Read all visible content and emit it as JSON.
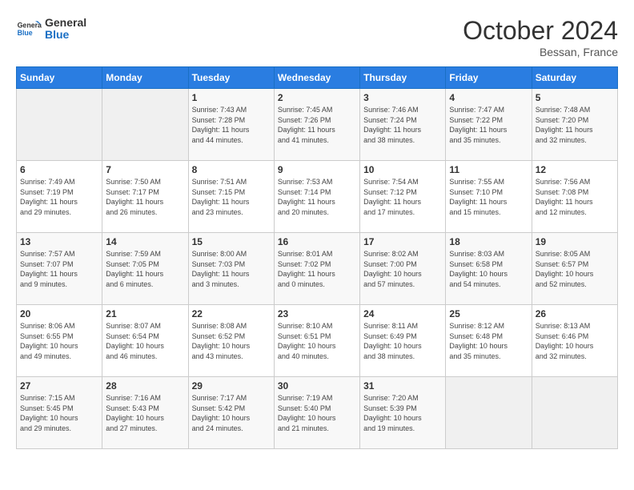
{
  "logo": {
    "line1": "General",
    "line2": "Blue"
  },
  "title": "October 2024",
  "location": "Bessan, France",
  "days_header": [
    "Sunday",
    "Monday",
    "Tuesday",
    "Wednesday",
    "Thursday",
    "Friday",
    "Saturday"
  ],
  "weeks": [
    [
      {
        "day": "",
        "info": ""
      },
      {
        "day": "",
        "info": ""
      },
      {
        "day": "1",
        "info": "Sunrise: 7:43 AM\nSunset: 7:28 PM\nDaylight: 11 hours\nand 44 minutes."
      },
      {
        "day": "2",
        "info": "Sunrise: 7:45 AM\nSunset: 7:26 PM\nDaylight: 11 hours\nand 41 minutes."
      },
      {
        "day": "3",
        "info": "Sunrise: 7:46 AM\nSunset: 7:24 PM\nDaylight: 11 hours\nand 38 minutes."
      },
      {
        "day": "4",
        "info": "Sunrise: 7:47 AM\nSunset: 7:22 PM\nDaylight: 11 hours\nand 35 minutes."
      },
      {
        "day": "5",
        "info": "Sunrise: 7:48 AM\nSunset: 7:20 PM\nDaylight: 11 hours\nand 32 minutes."
      }
    ],
    [
      {
        "day": "6",
        "info": "Sunrise: 7:49 AM\nSunset: 7:19 PM\nDaylight: 11 hours\nand 29 minutes."
      },
      {
        "day": "7",
        "info": "Sunrise: 7:50 AM\nSunset: 7:17 PM\nDaylight: 11 hours\nand 26 minutes."
      },
      {
        "day": "8",
        "info": "Sunrise: 7:51 AM\nSunset: 7:15 PM\nDaylight: 11 hours\nand 23 minutes."
      },
      {
        "day": "9",
        "info": "Sunrise: 7:53 AM\nSunset: 7:14 PM\nDaylight: 11 hours\nand 20 minutes."
      },
      {
        "day": "10",
        "info": "Sunrise: 7:54 AM\nSunset: 7:12 PM\nDaylight: 11 hours\nand 17 minutes."
      },
      {
        "day": "11",
        "info": "Sunrise: 7:55 AM\nSunset: 7:10 PM\nDaylight: 11 hours\nand 15 minutes."
      },
      {
        "day": "12",
        "info": "Sunrise: 7:56 AM\nSunset: 7:08 PM\nDaylight: 11 hours\nand 12 minutes."
      }
    ],
    [
      {
        "day": "13",
        "info": "Sunrise: 7:57 AM\nSunset: 7:07 PM\nDaylight: 11 hours\nand 9 minutes."
      },
      {
        "day": "14",
        "info": "Sunrise: 7:59 AM\nSunset: 7:05 PM\nDaylight: 11 hours\nand 6 minutes."
      },
      {
        "day": "15",
        "info": "Sunrise: 8:00 AM\nSunset: 7:03 PM\nDaylight: 11 hours\nand 3 minutes."
      },
      {
        "day": "16",
        "info": "Sunrise: 8:01 AM\nSunset: 7:02 PM\nDaylight: 11 hours\nand 0 minutes."
      },
      {
        "day": "17",
        "info": "Sunrise: 8:02 AM\nSunset: 7:00 PM\nDaylight: 10 hours\nand 57 minutes."
      },
      {
        "day": "18",
        "info": "Sunrise: 8:03 AM\nSunset: 6:58 PM\nDaylight: 10 hours\nand 54 minutes."
      },
      {
        "day": "19",
        "info": "Sunrise: 8:05 AM\nSunset: 6:57 PM\nDaylight: 10 hours\nand 52 minutes."
      }
    ],
    [
      {
        "day": "20",
        "info": "Sunrise: 8:06 AM\nSunset: 6:55 PM\nDaylight: 10 hours\nand 49 minutes."
      },
      {
        "day": "21",
        "info": "Sunrise: 8:07 AM\nSunset: 6:54 PM\nDaylight: 10 hours\nand 46 minutes."
      },
      {
        "day": "22",
        "info": "Sunrise: 8:08 AM\nSunset: 6:52 PM\nDaylight: 10 hours\nand 43 minutes."
      },
      {
        "day": "23",
        "info": "Sunrise: 8:10 AM\nSunset: 6:51 PM\nDaylight: 10 hours\nand 40 minutes."
      },
      {
        "day": "24",
        "info": "Sunrise: 8:11 AM\nSunset: 6:49 PM\nDaylight: 10 hours\nand 38 minutes."
      },
      {
        "day": "25",
        "info": "Sunrise: 8:12 AM\nSunset: 6:48 PM\nDaylight: 10 hours\nand 35 minutes."
      },
      {
        "day": "26",
        "info": "Sunrise: 8:13 AM\nSunset: 6:46 PM\nDaylight: 10 hours\nand 32 minutes."
      }
    ],
    [
      {
        "day": "27",
        "info": "Sunrise: 7:15 AM\nSunset: 5:45 PM\nDaylight: 10 hours\nand 29 minutes."
      },
      {
        "day": "28",
        "info": "Sunrise: 7:16 AM\nSunset: 5:43 PM\nDaylight: 10 hours\nand 27 minutes."
      },
      {
        "day": "29",
        "info": "Sunrise: 7:17 AM\nSunset: 5:42 PM\nDaylight: 10 hours\nand 24 minutes."
      },
      {
        "day": "30",
        "info": "Sunrise: 7:19 AM\nSunset: 5:40 PM\nDaylight: 10 hours\nand 21 minutes."
      },
      {
        "day": "31",
        "info": "Sunrise: 7:20 AM\nSunset: 5:39 PM\nDaylight: 10 hours\nand 19 minutes."
      },
      {
        "day": "",
        "info": ""
      },
      {
        "day": "",
        "info": ""
      }
    ]
  ]
}
